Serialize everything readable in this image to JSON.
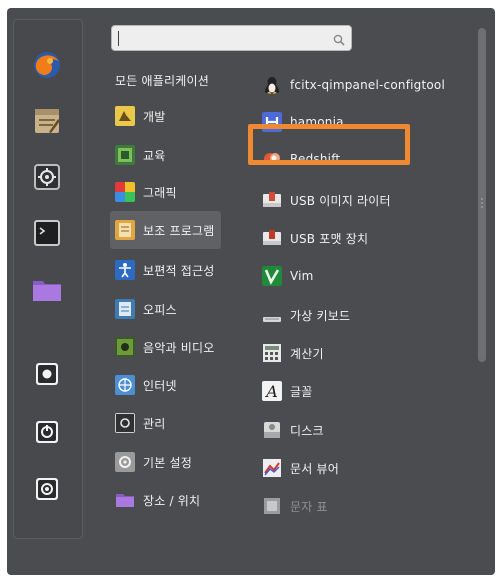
{
  "search": {
    "placeholder": "",
    "value": ""
  },
  "favorites": [
    {
      "icon": "firefox-icon"
    },
    {
      "icon": "text-editor-icon"
    },
    {
      "icon": "settings-icon"
    },
    {
      "icon": "terminal-icon"
    },
    {
      "icon": "folder-icon"
    },
    {
      "icon": "power-icon"
    },
    {
      "icon": "power-icon"
    },
    {
      "icon": "power-icon"
    }
  ],
  "categories": [
    {
      "label": "모든 애플리케이션",
      "icon": "",
      "selected": false
    },
    {
      "label": "개발",
      "icon": "development-icon",
      "selected": false
    },
    {
      "label": "교육",
      "icon": "education-icon",
      "selected": false
    },
    {
      "label": "그래픽",
      "icon": "graphics-icon",
      "selected": false
    },
    {
      "label": "보조 프로그램",
      "icon": "accessories-icon",
      "selected": true
    },
    {
      "label": "보편적 접근성",
      "icon": "accessibility-icon",
      "selected": false
    },
    {
      "label": "오피스",
      "icon": "office-icon",
      "selected": false
    },
    {
      "label": "음악과 비디오",
      "icon": "multimedia-icon",
      "selected": false
    },
    {
      "label": "인터넷",
      "icon": "internet-icon",
      "selected": false
    },
    {
      "label": "관리",
      "icon": "administration-icon",
      "selected": false
    },
    {
      "label": "기본 설정",
      "icon": "preferences-icon",
      "selected": false
    },
    {
      "label": "장소 / 위치",
      "icon": "places-icon",
      "selected": false
    }
  ],
  "apps": [
    {
      "label": "fcitx-qimpanel-configtool",
      "icon": "fcitx-icon",
      "disabled": false
    },
    {
      "label": "hamonia",
      "icon": "hamonia-icon",
      "disabled": false
    },
    {
      "label": "Redshift",
      "icon": "redshift-icon",
      "disabled": false
    },
    {
      "label": "USB 이미지 라이터",
      "icon": "usb-writer-icon",
      "disabled": false
    },
    {
      "label": "USB 포맷 장치",
      "icon": "usb-format-icon",
      "disabled": false
    },
    {
      "label": "Vim",
      "icon": "vim-icon",
      "disabled": false
    },
    {
      "label": "가상 키보드",
      "icon": "keyboard-icon",
      "disabled": false
    },
    {
      "label": "계산기",
      "icon": "calculator-icon",
      "disabled": false
    },
    {
      "label": "글꼴",
      "icon": "font-icon",
      "disabled": false
    },
    {
      "label": "디스크",
      "icon": "disks-icon",
      "disabled": false
    },
    {
      "label": "문서 뷰어",
      "icon": "document-viewer-icon",
      "disabled": false
    },
    {
      "label": "문자 표",
      "icon": "character-map-icon",
      "disabled": true
    }
  ],
  "colors": {
    "panel": "#4a4c4f",
    "selection": "#5f6164",
    "highlight": "#f08a32"
  }
}
